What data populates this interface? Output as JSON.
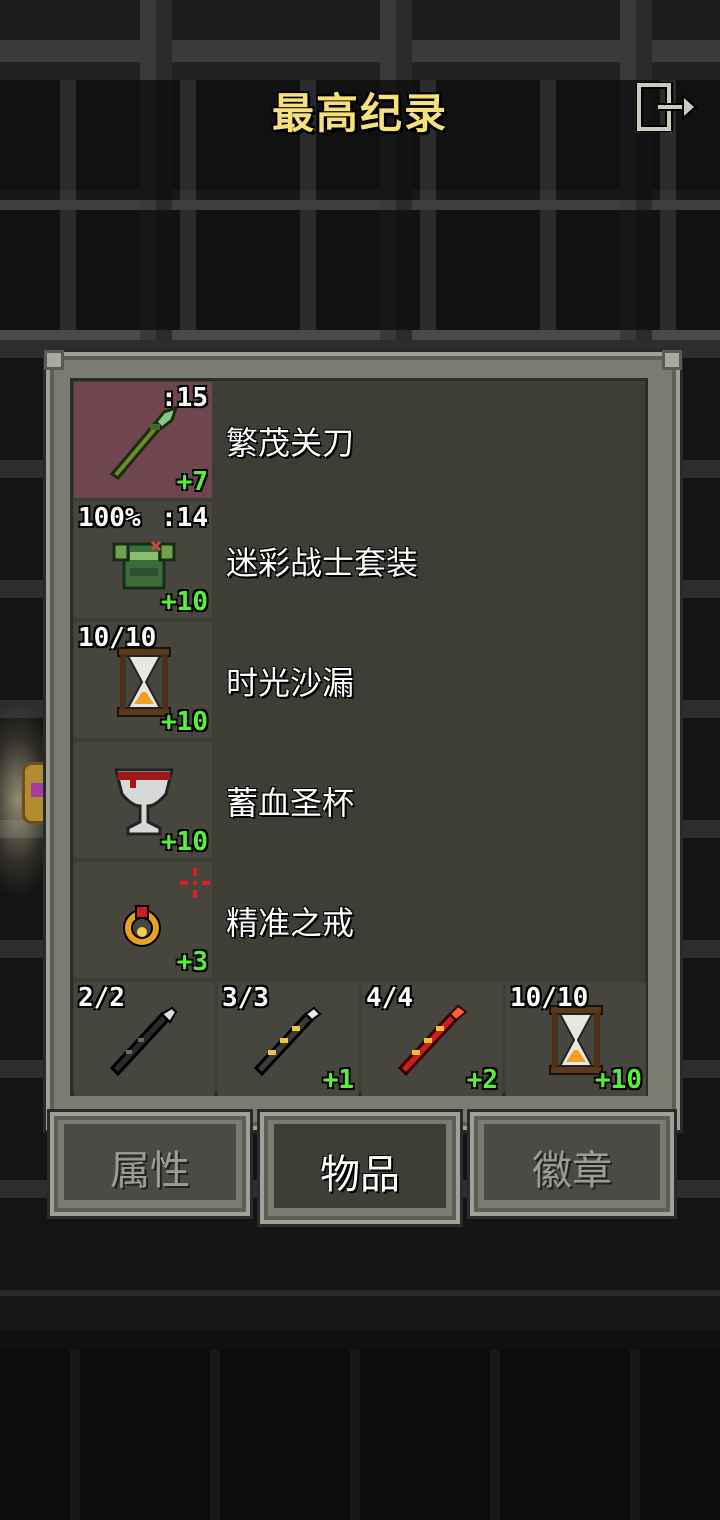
{
  "title": "最高纪录",
  "exit_icon": "exit-icon",
  "items": [
    {
      "name": "繁茂关刀",
      "badge_tl": "",
      "badge_tr": ":15",
      "level": "+7",
      "icon": "glaive-icon",
      "highlight": true
    },
    {
      "name": "迷彩战士套装",
      "badge_tl": "100%",
      "badge_tr": ":14",
      "level": "+10",
      "icon": "armor-icon",
      "highlight": false
    },
    {
      "name": "时光沙漏",
      "badge_tl": "10/10",
      "badge_tr": "",
      "level": "+10",
      "icon": "hourglass-icon",
      "highlight": false
    },
    {
      "name": "蓄血圣杯",
      "badge_tl": "",
      "badge_tr": "",
      "level": "+10",
      "icon": "chalice-icon",
      "highlight": false
    },
    {
      "name": "精准之戒",
      "badge_tl": "",
      "badge_tr": "",
      "level": "+3",
      "icon": "ring-icon",
      "highlight": false
    }
  ],
  "quick_slots": [
    {
      "charges": "2/2",
      "level": "",
      "icon": "dark-wand-icon"
    },
    {
      "charges": "3/3",
      "level": "+1",
      "icon": "gold-wand-icon"
    },
    {
      "charges": "4/4",
      "level": "+2",
      "icon": "fire-wand-icon"
    },
    {
      "charges": "10/10",
      "level": "+10",
      "icon": "hourglass-icon"
    }
  ],
  "tabs": [
    {
      "label": "属性",
      "active": false
    },
    {
      "label": "物品",
      "active": true
    },
    {
      "label": "徽章",
      "active": false
    }
  ],
  "colors": {
    "title": "#f6e07a",
    "level_text": "#59f03a",
    "panel": "#7a7c72",
    "slot": "#46463f",
    "highlight_slot": "#6f4650"
  }
}
